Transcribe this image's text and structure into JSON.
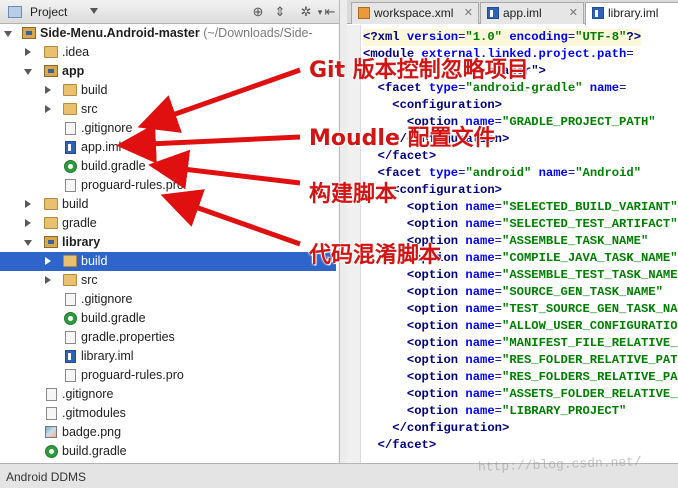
{
  "project_panel": {
    "title": "Project",
    "tree": [
      {
        "label": "Side-Menu.Android-master",
        "path": "(~/Downloads/Side-",
        "bold": true
      },
      {
        "label": ".idea"
      },
      {
        "label": "app",
        "bold": true
      },
      {
        "label": "build"
      },
      {
        "label": "src"
      },
      {
        "label": ".gitignore"
      },
      {
        "label": "app.iml"
      },
      {
        "label": "build.gradle"
      },
      {
        "label": "proguard-rules.pro"
      },
      {
        "label": "build"
      },
      {
        "label": "gradle"
      },
      {
        "label": "library",
        "bold": true
      },
      {
        "label": "build"
      },
      {
        "label": "src"
      },
      {
        "label": ".gitignore"
      },
      {
        "label": "build.gradle"
      },
      {
        "label": "gradle.properties"
      },
      {
        "label": "library.iml"
      },
      {
        "label": "proguard-rules.pro"
      },
      {
        "label": ".gitignore"
      },
      {
        "label": ".gitmodules"
      },
      {
        "label": "badge.png"
      },
      {
        "label": "build.gradle"
      }
    ],
    "selected_index": 12
  },
  "editor": {
    "tabs": [
      {
        "label": "workspace.xml",
        "icon": "xml-file-icon",
        "active": false
      },
      {
        "label": "app.iml",
        "icon": "iml-file-icon",
        "active": false
      },
      {
        "label": "library.iml",
        "icon": "iml-file-icon",
        "active": true
      }
    ],
    "lines": [
      {
        "indent": "",
        "parts": [
          [
            "tag",
            "<?xml "
          ],
          [
            "attr",
            "version"
          ],
          [
            "eq",
            "="
          ],
          [
            "val",
            "\"1.0\""
          ],
          [
            "eq",
            " "
          ],
          [
            "attr",
            "encoding"
          ],
          [
            "eq",
            "="
          ],
          [
            "val",
            "\"UTF-8\""
          ],
          [
            "tag",
            "?>"
          ]
        ]
      },
      {
        "indent": "",
        "parts": [
          [
            "tag",
            "<module "
          ],
          [
            "attr",
            "external.linked.project.path"
          ],
          [
            "eq",
            "="
          ]
        ]
      },
      {
        "indent": "",
        "parts": [
          [
            "tag",
            "                 anager\">"
          ]
        ]
      },
      {
        "indent": "  ",
        "parts": [
          [
            "tag",
            "<facet "
          ],
          [
            "attr",
            "type"
          ],
          [
            "eq",
            "="
          ],
          [
            "val",
            "\"android-gradle\""
          ],
          [
            "eq",
            " "
          ],
          [
            "attr",
            "name"
          ],
          [
            "eq",
            "="
          ]
        ]
      },
      {
        "indent": "    ",
        "parts": [
          [
            "tag",
            "<configuration>"
          ]
        ]
      },
      {
        "indent": "      ",
        "parts": [
          [
            "tag",
            "<option "
          ],
          [
            "attr",
            "name"
          ],
          [
            "eq",
            "="
          ],
          [
            "val",
            "\"GRADLE_PROJECT_PATH\""
          ]
        ]
      },
      {
        "indent": "    ",
        "parts": [
          [
            "tag",
            "</configuration>"
          ]
        ]
      },
      {
        "indent": "  ",
        "parts": [
          [
            "tag",
            "</facet>"
          ]
        ]
      },
      {
        "indent": "  ",
        "parts": [
          [
            "tag",
            "<facet "
          ],
          [
            "attr",
            "type"
          ],
          [
            "eq",
            "="
          ],
          [
            "val",
            "\"android\""
          ],
          [
            "eq",
            " "
          ],
          [
            "attr",
            "name"
          ],
          [
            "eq",
            "="
          ],
          [
            "val",
            "\"Android\""
          ]
        ]
      },
      {
        "indent": "    ",
        "parts": [
          [
            "tag",
            "<configuration>"
          ]
        ]
      },
      {
        "indent": "      ",
        "parts": [
          [
            "tag",
            "<option "
          ],
          [
            "attr",
            "name"
          ],
          [
            "eq",
            "="
          ],
          [
            "val",
            "\"SELECTED_BUILD_VARIANT\""
          ]
        ]
      },
      {
        "indent": "      ",
        "parts": [
          [
            "tag",
            "<option "
          ],
          [
            "attr",
            "name"
          ],
          [
            "eq",
            "="
          ],
          [
            "val",
            "\"SELECTED_TEST_ARTIFACT\""
          ]
        ]
      },
      {
        "indent": "      ",
        "parts": [
          [
            "tag",
            "<option "
          ],
          [
            "attr",
            "name"
          ],
          [
            "eq",
            "="
          ],
          [
            "val",
            "\"ASSEMBLE_TASK_NAME\""
          ]
        ]
      },
      {
        "indent": "      ",
        "parts": [
          [
            "tag",
            "<option "
          ],
          [
            "attr",
            "name"
          ],
          [
            "eq",
            "="
          ],
          [
            "val",
            "\"COMPILE_JAVA_TASK_NAME\""
          ]
        ]
      },
      {
        "indent": "      ",
        "parts": [
          [
            "tag",
            "<option "
          ],
          [
            "attr",
            "name"
          ],
          [
            "eq",
            "="
          ],
          [
            "val",
            "\"ASSEMBLE_TEST_TASK_NAME\""
          ]
        ]
      },
      {
        "indent": "      ",
        "parts": [
          [
            "tag",
            "<option "
          ],
          [
            "attr",
            "name"
          ],
          [
            "eq",
            "="
          ],
          [
            "val",
            "\"SOURCE_GEN_TASK_NAME\""
          ]
        ]
      },
      {
        "indent": "      ",
        "parts": [
          [
            "tag",
            "<option "
          ],
          [
            "attr",
            "name"
          ],
          [
            "eq",
            "="
          ],
          [
            "val",
            "\"TEST_SOURCE_GEN_TASK_NAME\""
          ]
        ]
      },
      {
        "indent": "      ",
        "parts": [
          [
            "tag",
            "<option "
          ],
          [
            "attr",
            "name"
          ],
          [
            "eq",
            "="
          ],
          [
            "val",
            "\"ALLOW_USER_CONFIGURATION\""
          ]
        ]
      },
      {
        "indent": "      ",
        "parts": [
          [
            "tag",
            "<option "
          ],
          [
            "attr",
            "name"
          ],
          [
            "eq",
            "="
          ],
          [
            "val",
            "\"MANIFEST_FILE_RELATIVE_PATH\""
          ]
        ]
      },
      {
        "indent": "      ",
        "parts": [
          [
            "tag",
            "<option "
          ],
          [
            "attr",
            "name"
          ],
          [
            "eq",
            "="
          ],
          [
            "val",
            "\"RES_FOLDER_RELATIVE_PATH\""
          ]
        ]
      },
      {
        "indent": "      ",
        "parts": [
          [
            "tag",
            "<option "
          ],
          [
            "attr",
            "name"
          ],
          [
            "eq",
            "="
          ],
          [
            "val",
            "\"RES_FOLDERS_RELATIVE_PATH\""
          ]
        ]
      },
      {
        "indent": "      ",
        "parts": [
          [
            "tag",
            "<option "
          ],
          [
            "attr",
            "name"
          ],
          [
            "eq",
            "="
          ],
          [
            "val",
            "\"ASSETS_FOLDER_RELATIVE_PATH\""
          ]
        ]
      },
      {
        "indent": "      ",
        "parts": [
          [
            "tag",
            "<option "
          ],
          [
            "attr",
            "name"
          ],
          [
            "eq",
            "="
          ],
          [
            "val",
            "\"LIBRARY_PROJECT\""
          ]
        ]
      },
      {
        "indent": "    ",
        "parts": [
          [
            "tag",
            "</configuration>"
          ]
        ]
      },
      {
        "indent": "  ",
        "parts": [
          [
            "tag",
            "</facet>"
          ]
        ]
      }
    ]
  },
  "status_bar": {
    "left_label": "Android DDMS"
  },
  "watermark": "http://blog.csdn.net/",
  "annotations": [
    {
      "text": "Git 版本控制忽略项目",
      "color": "#d21414"
    },
    {
      "text": "Moudle 配置文件",
      "color": "#d21414"
    },
    {
      "text": "构建脚本",
      "color": "#d21414"
    },
    {
      "text": "代码混淆脚本",
      "color": "#d21414"
    }
  ]
}
